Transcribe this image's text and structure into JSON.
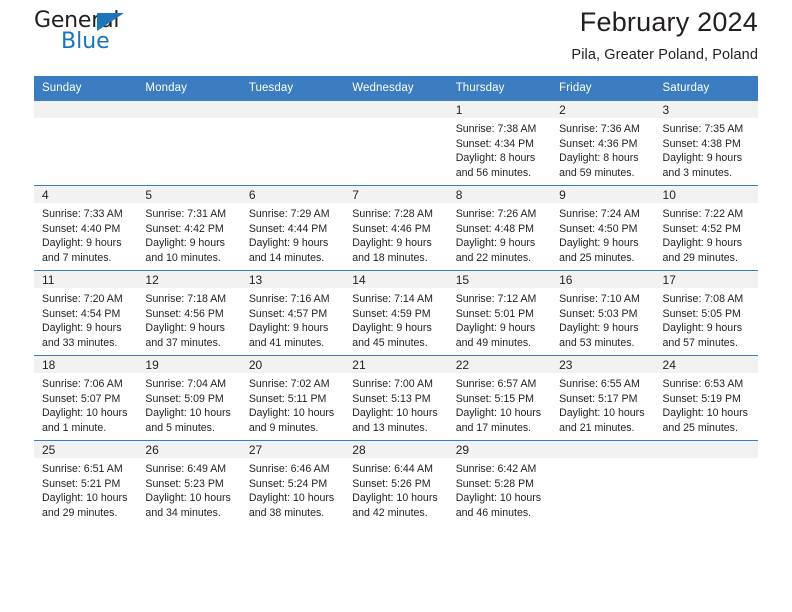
{
  "brand": {
    "name_top": "General",
    "name_bottom": "Blue",
    "accent_color": "#1b75bb"
  },
  "header": {
    "title": "February 2024",
    "subtitle": "Pila, Greater Poland, Poland"
  },
  "theme": {
    "header_blue": "#3b7dc0",
    "daynum_band": "#f2f2f2",
    "text": "#231f20"
  },
  "calendar": {
    "weekday_headers": [
      "Sunday",
      "Monday",
      "Tuesday",
      "Wednesday",
      "Thursday",
      "Friday",
      "Saturday"
    ],
    "weeks": [
      [
        {
          "day": "",
          "empty": true
        },
        {
          "day": "",
          "empty": true
        },
        {
          "day": "",
          "empty": true
        },
        {
          "day": "",
          "empty": true
        },
        {
          "day": "1",
          "sunrise": "Sunrise: 7:38 AM",
          "sunset": "Sunset: 4:34 PM",
          "daylight_line1": "Daylight: 8 hours",
          "daylight_line2": "and 56 minutes."
        },
        {
          "day": "2",
          "sunrise": "Sunrise: 7:36 AM",
          "sunset": "Sunset: 4:36 PM",
          "daylight_line1": "Daylight: 8 hours",
          "daylight_line2": "and 59 minutes."
        },
        {
          "day": "3",
          "sunrise": "Sunrise: 7:35 AM",
          "sunset": "Sunset: 4:38 PM",
          "daylight_line1": "Daylight: 9 hours",
          "daylight_line2": "and 3 minutes."
        }
      ],
      [
        {
          "day": "4",
          "sunrise": "Sunrise: 7:33 AM",
          "sunset": "Sunset: 4:40 PM",
          "daylight_line1": "Daylight: 9 hours",
          "daylight_line2": "and 7 minutes."
        },
        {
          "day": "5",
          "sunrise": "Sunrise: 7:31 AM",
          "sunset": "Sunset: 4:42 PM",
          "daylight_line1": "Daylight: 9 hours",
          "daylight_line2": "and 10 minutes."
        },
        {
          "day": "6",
          "sunrise": "Sunrise: 7:29 AM",
          "sunset": "Sunset: 4:44 PM",
          "daylight_line1": "Daylight: 9 hours",
          "daylight_line2": "and 14 minutes."
        },
        {
          "day": "7",
          "sunrise": "Sunrise: 7:28 AM",
          "sunset": "Sunset: 4:46 PM",
          "daylight_line1": "Daylight: 9 hours",
          "daylight_line2": "and 18 minutes."
        },
        {
          "day": "8",
          "sunrise": "Sunrise: 7:26 AM",
          "sunset": "Sunset: 4:48 PM",
          "daylight_line1": "Daylight: 9 hours",
          "daylight_line2": "and 22 minutes."
        },
        {
          "day": "9",
          "sunrise": "Sunrise: 7:24 AM",
          "sunset": "Sunset: 4:50 PM",
          "daylight_line1": "Daylight: 9 hours",
          "daylight_line2": "and 25 minutes."
        },
        {
          "day": "10",
          "sunrise": "Sunrise: 7:22 AM",
          "sunset": "Sunset: 4:52 PM",
          "daylight_line1": "Daylight: 9 hours",
          "daylight_line2": "and 29 minutes."
        }
      ],
      [
        {
          "day": "11",
          "sunrise": "Sunrise: 7:20 AM",
          "sunset": "Sunset: 4:54 PM",
          "daylight_line1": "Daylight: 9 hours",
          "daylight_line2": "and 33 minutes."
        },
        {
          "day": "12",
          "sunrise": "Sunrise: 7:18 AM",
          "sunset": "Sunset: 4:56 PM",
          "daylight_line1": "Daylight: 9 hours",
          "daylight_line2": "and 37 minutes."
        },
        {
          "day": "13",
          "sunrise": "Sunrise: 7:16 AM",
          "sunset": "Sunset: 4:57 PM",
          "daylight_line1": "Daylight: 9 hours",
          "daylight_line2": "and 41 minutes."
        },
        {
          "day": "14",
          "sunrise": "Sunrise: 7:14 AM",
          "sunset": "Sunset: 4:59 PM",
          "daylight_line1": "Daylight: 9 hours",
          "daylight_line2": "and 45 minutes."
        },
        {
          "day": "15",
          "sunrise": "Sunrise: 7:12 AM",
          "sunset": "Sunset: 5:01 PM",
          "daylight_line1": "Daylight: 9 hours",
          "daylight_line2": "and 49 minutes."
        },
        {
          "day": "16",
          "sunrise": "Sunrise: 7:10 AM",
          "sunset": "Sunset: 5:03 PM",
          "daylight_line1": "Daylight: 9 hours",
          "daylight_line2": "and 53 minutes."
        },
        {
          "day": "17",
          "sunrise": "Sunrise: 7:08 AM",
          "sunset": "Sunset: 5:05 PM",
          "daylight_line1": "Daylight: 9 hours",
          "daylight_line2": "and 57 minutes."
        }
      ],
      [
        {
          "day": "18",
          "sunrise": "Sunrise: 7:06 AM",
          "sunset": "Sunset: 5:07 PM",
          "daylight_line1": "Daylight: 10 hours",
          "daylight_line2": "and 1 minute."
        },
        {
          "day": "19",
          "sunrise": "Sunrise: 7:04 AM",
          "sunset": "Sunset: 5:09 PM",
          "daylight_line1": "Daylight: 10 hours",
          "daylight_line2": "and 5 minutes."
        },
        {
          "day": "20",
          "sunrise": "Sunrise: 7:02 AM",
          "sunset": "Sunset: 5:11 PM",
          "daylight_line1": "Daylight: 10 hours",
          "daylight_line2": "and 9 minutes."
        },
        {
          "day": "21",
          "sunrise": "Sunrise: 7:00 AM",
          "sunset": "Sunset: 5:13 PM",
          "daylight_line1": "Daylight: 10 hours",
          "daylight_line2": "and 13 minutes."
        },
        {
          "day": "22",
          "sunrise": "Sunrise: 6:57 AM",
          "sunset": "Sunset: 5:15 PM",
          "daylight_line1": "Daylight: 10 hours",
          "daylight_line2": "and 17 minutes."
        },
        {
          "day": "23",
          "sunrise": "Sunrise: 6:55 AM",
          "sunset": "Sunset: 5:17 PM",
          "daylight_line1": "Daylight: 10 hours",
          "daylight_line2": "and 21 minutes."
        },
        {
          "day": "24",
          "sunrise": "Sunrise: 6:53 AM",
          "sunset": "Sunset: 5:19 PM",
          "daylight_line1": "Daylight: 10 hours",
          "daylight_line2": "and 25 minutes."
        }
      ],
      [
        {
          "day": "25",
          "sunrise": "Sunrise: 6:51 AM",
          "sunset": "Sunset: 5:21 PM",
          "daylight_line1": "Daylight: 10 hours",
          "daylight_line2": "and 29 minutes."
        },
        {
          "day": "26",
          "sunrise": "Sunrise: 6:49 AM",
          "sunset": "Sunset: 5:23 PM",
          "daylight_line1": "Daylight: 10 hours",
          "daylight_line2": "and 34 minutes."
        },
        {
          "day": "27",
          "sunrise": "Sunrise: 6:46 AM",
          "sunset": "Sunset: 5:24 PM",
          "daylight_line1": "Daylight: 10 hours",
          "daylight_line2": "and 38 minutes."
        },
        {
          "day": "28",
          "sunrise": "Sunrise: 6:44 AM",
          "sunset": "Sunset: 5:26 PM",
          "daylight_line1": "Daylight: 10 hours",
          "daylight_line2": "and 42 minutes."
        },
        {
          "day": "29",
          "sunrise": "Sunrise: 6:42 AM",
          "sunset": "Sunset: 5:28 PM",
          "daylight_line1": "Daylight: 10 hours",
          "daylight_line2": "and 46 minutes."
        },
        {
          "day": "",
          "empty": true
        },
        {
          "day": "",
          "empty": true
        }
      ]
    ]
  }
}
